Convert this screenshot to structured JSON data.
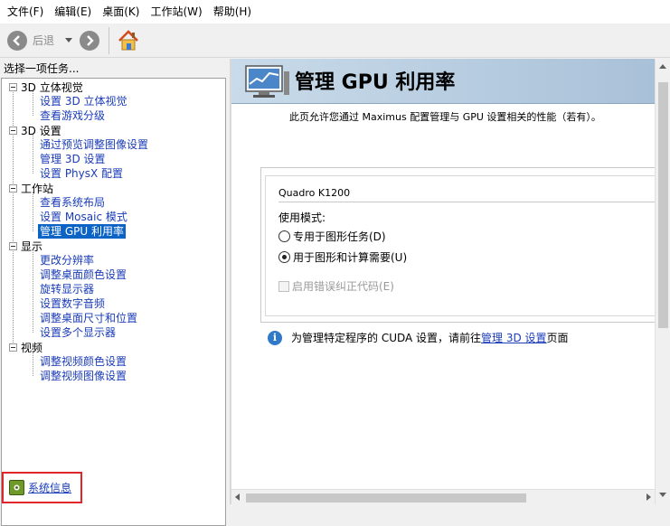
{
  "menu": [
    "文件(F)",
    "编辑(E)",
    "桌面(K)",
    "工作站(W)",
    "帮助(H)"
  ],
  "toolbar": {
    "back_label": "后退",
    "back_icon": "back-arrow-icon",
    "forward_icon": "forward-arrow-icon",
    "home_icon": "home-icon"
  },
  "task_panel": {
    "header": "选择一项任务...",
    "categories": [
      {
        "label": "3D 立体视觉",
        "items": [
          "设置 3D 立体视觉",
          "查看游戏分级"
        ]
      },
      {
        "label": "3D 设置",
        "items": [
          "通过预览调整图像设置",
          "管理 3D 设置",
          "设置 PhysX 配置"
        ]
      },
      {
        "label": "工作站",
        "items": [
          "查看系统布局",
          "设置 Mosaic 模式",
          "管理 GPU 利用率"
        ]
      },
      {
        "label": "显示",
        "items": [
          "更改分辨率",
          "调整桌面颜色设置",
          "旋转显示器",
          "设置数字音频",
          "调整桌面尺寸和位置",
          "设置多个显示器"
        ]
      },
      {
        "label": "视频",
        "items": [
          "调整视频颜色设置",
          "调整视频图像设置"
        ]
      }
    ],
    "selected_item": "管理 GPU 利用率",
    "system_info_link": "系统信息"
  },
  "content": {
    "title": "管理 GPU 利用率",
    "description": "此页允许您通过 Maximus 配置管理与 GPU 设置相关的性能（若有）。",
    "gpu_name": "Quadro K1200",
    "usage_mode_label": "使用模式:",
    "options": [
      {
        "label": "专用于图形任务(D)",
        "checked": false
      },
      {
        "label": "用于图形和计算需要(U)",
        "checked": true
      }
    ],
    "ecc_label": "启用错误纠正代码(E)",
    "ecc_enabled": false,
    "info_text_prefix": "为管理特定程序的 CUDA 设置，请前往",
    "info_link": "管理 3D 设置",
    "info_text_suffix": "页面"
  },
  "colors": {
    "link": "#1a3cb8",
    "selected_bg": "#0b63c6",
    "highlight_border": "#e0262a",
    "banner": "#b9cde0"
  }
}
